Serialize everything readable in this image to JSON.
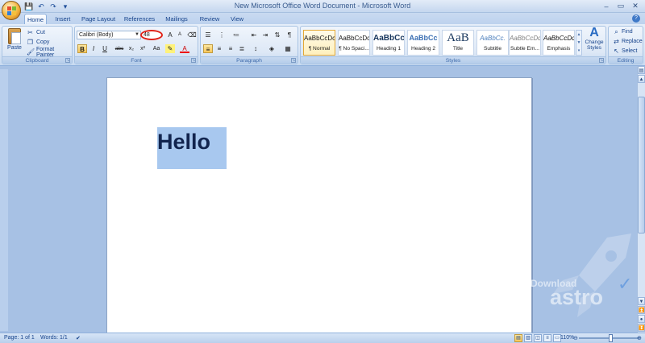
{
  "window": {
    "title": "New Microsoft Office Word Document - Microsoft Word",
    "controls": [
      "–",
      "▭",
      "✕"
    ]
  },
  "quick_access": [
    "save-icon",
    "undo-icon",
    "redo-icon",
    "customize-icon"
  ],
  "tabs": [
    {
      "label": "Home",
      "active": true
    },
    {
      "label": "Insert"
    },
    {
      "label": "Page Layout"
    },
    {
      "label": "References"
    },
    {
      "label": "Mailings"
    },
    {
      "label": "Review"
    },
    {
      "label": "View"
    }
  ],
  "ribbon": {
    "clipboard": {
      "label": "Clipboard",
      "paste": "Paste",
      "cut": "Cut",
      "copy": "Copy",
      "format_painter": "Format Painter"
    },
    "font": {
      "label": "Font",
      "font_name": "Calibri (Body)",
      "font_size": "48",
      "bold": "B",
      "italic": "I",
      "underline": "U",
      "strikethrough": "abc",
      "subscript": "x₂",
      "superscript": "x²",
      "change_case": "Aa",
      "grow": "A",
      "shrink": "A"
    },
    "paragraph": {
      "label": "Paragraph"
    },
    "styles": {
      "label": "Styles",
      "items": [
        {
          "sample": "AaBbCcDc",
          "label": "¶ Normal"
        },
        {
          "sample": "AaBbCcDc",
          "label": "¶ No Spaci..."
        },
        {
          "sample": "AaBbCc",
          "label": "Heading 1"
        },
        {
          "sample": "AaBbCc",
          "label": "Heading 2"
        },
        {
          "sample": "AaB",
          "label": "Title"
        },
        {
          "sample": "AaBbCc.",
          "label": "Subtitle"
        },
        {
          "sample": "AaBbCcDc",
          "label": "Subtle Em..."
        },
        {
          "sample": "AaBbCcDc",
          "label": "Emphasis"
        }
      ],
      "change_styles": "Change Styles"
    },
    "editing": {
      "label": "Editing",
      "find": "Find",
      "replace": "Replace",
      "select": "Select"
    }
  },
  "document": {
    "text": "Hello"
  },
  "status": {
    "page": "Page: 1 of 1",
    "words": "Words: 1/1",
    "zoom": "110%"
  },
  "watermark": {
    "line1": "Download",
    "line2": "astro"
  }
}
